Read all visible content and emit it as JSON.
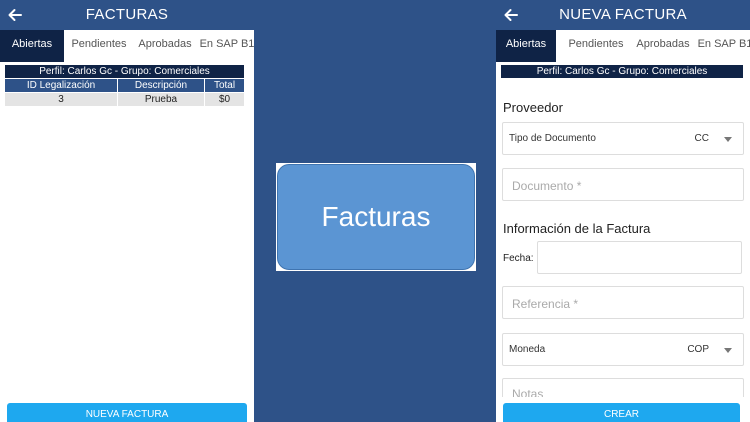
{
  "left": {
    "title": "FACTURAS",
    "tabs": [
      "Abiertas",
      "Pendientes",
      "Aprobadas",
      "En SAP B1"
    ],
    "profile": "Perfil: Carlos Gc - Grupo: Comerciales",
    "table": {
      "headers": [
        "ID Legalización",
        "Descripción",
        "Total"
      ],
      "rows": [
        [
          "3",
          "Prueba",
          "$0"
        ]
      ]
    },
    "button": "NUEVA FACTURA"
  },
  "center": {
    "label": "Facturas"
  },
  "right": {
    "title": "NUEVA FACTURA",
    "tabs": [
      "Abiertas",
      "Pendientes",
      "Aprobadas",
      "En SAP B1"
    ],
    "profile": "Perfil: Carlos Gc - Grupo: Comerciales",
    "section_proveedor": "Proveedor",
    "tipo_documento": {
      "label": "Tipo de Documento",
      "value": "CC"
    },
    "documento_placeholder": "Documento *",
    "section_factura": "Información de la Factura",
    "fecha_label": "Fecha:",
    "referencia_placeholder": "Referencia *",
    "moneda": {
      "label": "Moneda",
      "value": "COP"
    },
    "notas_placeholder": "Notas",
    "button": "CREAR"
  },
  "colors": {
    "primary": "#2e5288",
    "active_tab": "#0f2346",
    "accent": "#1ea8ef",
    "center_card": "#5b95d3"
  },
  "icons": {
    "back": "arrow-left-icon",
    "dropdown": "caret-down-icon"
  }
}
